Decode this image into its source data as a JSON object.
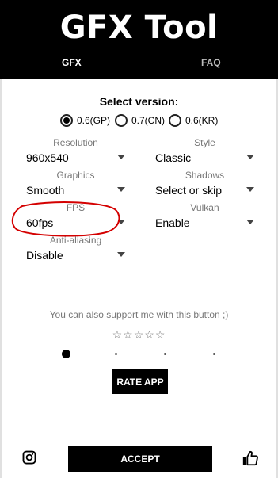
{
  "app": {
    "title": "GFX Tool"
  },
  "tabs": [
    {
      "label": "GFX"
    },
    {
      "label": "FAQ"
    }
  ],
  "version": {
    "title": "Select version:",
    "options": [
      {
        "label": "0.6(GP)",
        "checked": true
      },
      {
        "label": "0.7(CN)",
        "checked": false
      },
      {
        "label": "0.6(KR)",
        "checked": false
      }
    ]
  },
  "settings": {
    "resolution": {
      "label": "Resolution",
      "value": "960x540"
    },
    "style": {
      "label": "Style",
      "value": "Classic"
    },
    "graphics": {
      "label": "Graphics",
      "value": "Smooth"
    },
    "shadows": {
      "label": "Shadows",
      "value": "Select or skip"
    },
    "fps": {
      "label": "FPS",
      "value": "60fps"
    },
    "vulkan": {
      "label": "Vulkan",
      "value": "Enable"
    },
    "antialiasing": {
      "label": "Anti-aliasing",
      "value": "Disable"
    }
  },
  "support": {
    "text": "You can also support me with this button ;)",
    "stars": "☆☆☆☆☆",
    "rating": 0,
    "rate_button": "RATE APP"
  },
  "footer": {
    "accept_button": "ACCEPT",
    "left_icon": "instagram-icon",
    "right_icon": "thumbs-up-icon"
  },
  "colors": {
    "header_bg": "#000000",
    "annotation": "#d40000"
  }
}
